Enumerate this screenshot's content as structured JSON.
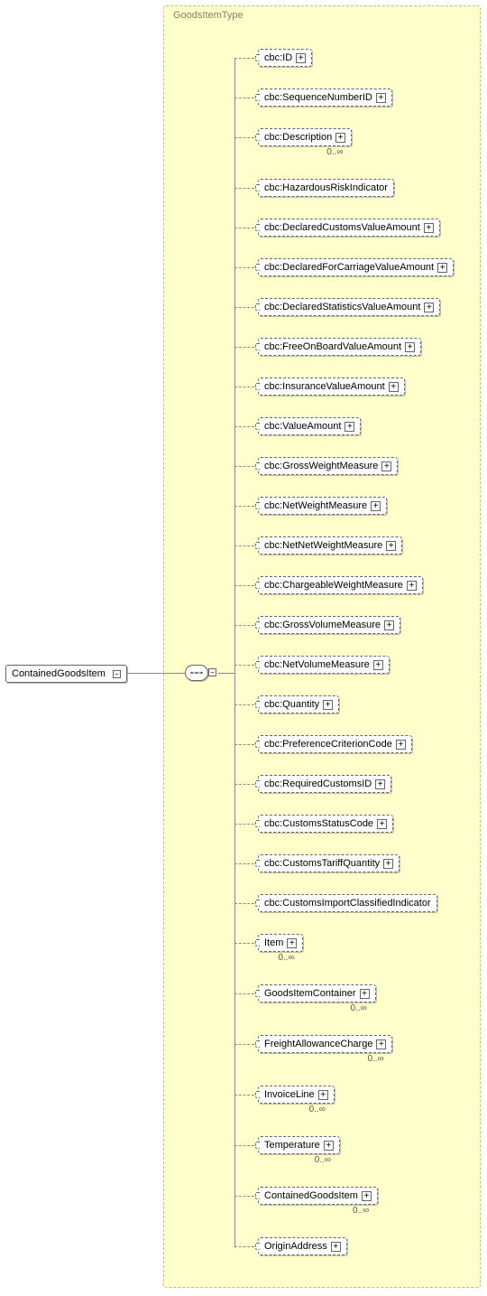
{
  "group": {
    "title": "GoodsItemType"
  },
  "root": {
    "label": "ContainedGoodsItem"
  },
  "children": [
    {
      "label": "cbc:ID",
      "key": "id"
    },
    {
      "label": "cbc:SequenceNumberID",
      "key": "sequenceNumberID"
    },
    {
      "label": "cbc:Description",
      "key": "description",
      "occur": "0..∞"
    },
    {
      "label": "cbc:HazardousRiskIndicator",
      "key": "hazardousRiskIndicator",
      "noExpander": true
    },
    {
      "label": "cbc:DeclaredCustomsValueAmount",
      "key": "declaredCustomsValueAmount"
    },
    {
      "label": "cbc:DeclaredForCarriageValueAmount",
      "key": "declaredForCarriageValueAmount"
    },
    {
      "label": "cbc:DeclaredStatisticsValueAmount",
      "key": "declaredStatisticsValueAmount"
    },
    {
      "label": "cbc:FreeOnBoardValueAmount",
      "key": "freeOnBoardValueAmount"
    },
    {
      "label": "cbc:InsuranceValueAmount",
      "key": "insuranceValueAmount"
    },
    {
      "label": "cbc:ValueAmount",
      "key": "valueAmount"
    },
    {
      "label": "cbc:GrossWeightMeasure",
      "key": "grossWeightMeasure"
    },
    {
      "label": "cbc:NetWeightMeasure",
      "key": "netWeightMeasure"
    },
    {
      "label": "cbc:NetNetWeightMeasure",
      "key": "netNetWeightMeasure"
    },
    {
      "label": "cbc:ChargeableWeightMeasure",
      "key": "chargeableWeightMeasure"
    },
    {
      "label": "cbc:GrossVolumeMeasure",
      "key": "grossVolumeMeasure"
    },
    {
      "label": "cbc:NetVolumeMeasure",
      "key": "netVolumeMeasure"
    },
    {
      "label": "cbc:Quantity",
      "key": "quantity"
    },
    {
      "label": "cbc:PreferenceCriterionCode",
      "key": "preferenceCriterionCode"
    },
    {
      "label": "cbc:RequiredCustomsID",
      "key": "requiredCustomsID"
    },
    {
      "label": "cbc:CustomsStatusCode",
      "key": "customsStatusCode"
    },
    {
      "label": "cbc:CustomsTariffQuantity",
      "key": "customsTariffQuantity"
    },
    {
      "label": "cbc:CustomsImportClassifiedIndicator",
      "key": "customsImportClassifiedIndicator",
      "noExpander": true
    },
    {
      "label": "Item",
      "key": "item",
      "occur": "0..∞"
    },
    {
      "label": "GoodsItemContainer",
      "key": "goodsItemContainer",
      "occur": "0..∞"
    },
    {
      "label": "FreightAllowanceCharge",
      "key": "freightAllowanceCharge",
      "occur": "0..∞"
    },
    {
      "label": "InvoiceLine",
      "key": "invoiceLine",
      "occur": "0..∞"
    },
    {
      "label": "Temperature",
      "key": "temperature",
      "occur": "0..∞"
    },
    {
      "label": "ContainedGoodsItem",
      "key": "containedGoodsItem",
      "occur": "0..∞"
    },
    {
      "label": "OriginAddress",
      "key": "originAddress"
    }
  ]
}
